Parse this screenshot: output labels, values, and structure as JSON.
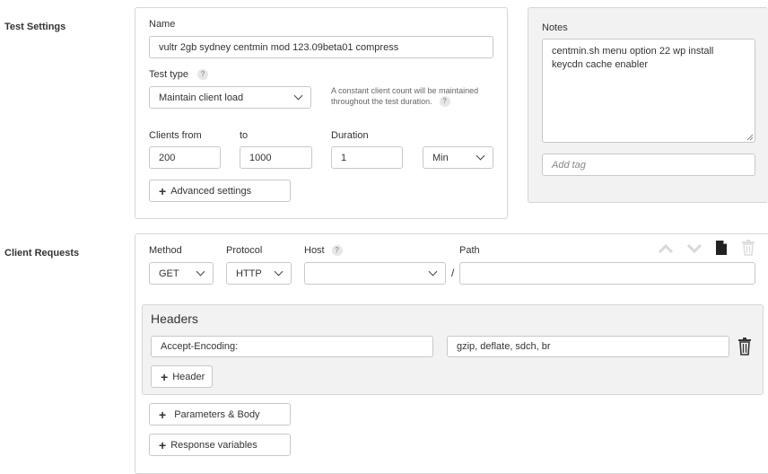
{
  "test_settings": {
    "section_label": "Test Settings",
    "name_label": "Name",
    "name_value": "vultr 2gb sydney centmin mod 123.09beta01 compress",
    "test_type_label": "Test type",
    "help_glyph": "?",
    "test_type_value": "Maintain client load",
    "test_type_hint_line1": "A constant client count will be maintained",
    "test_type_hint_line2": "throughout the test duration.",
    "clients_from_label": "Clients from",
    "clients_from_value": "200",
    "to_label": "to",
    "to_value": "1000",
    "duration_label": "Duration",
    "duration_value": "1",
    "duration_unit": "Min",
    "advanced_settings_label": "Advanced settings"
  },
  "notes": {
    "label": "Notes",
    "text": "centmin.sh menu option 22 wp install keycdn cache enabler",
    "tag_placeholder": "Add tag"
  },
  "client_requests": {
    "section_label": "Client Requests",
    "method_label": "Method",
    "method_value": "GET",
    "protocol_label": "Protocol",
    "protocol_value": "HTTP",
    "host_label": "Host",
    "host_value": "",
    "path_separator": "/",
    "path_label": "Path",
    "path_value": "",
    "headers_title": "Headers",
    "header_name": "Accept-Encoding:",
    "header_value": "gzip, deflate, sdch, br",
    "add_header_label": "Header",
    "parameters_body_label": "Parameters & Body",
    "response_variables_label": "Response variables"
  },
  "icons": [
    "chevron-up-icon",
    "chevron-down-icon",
    "file-icon",
    "trash-icon"
  ]
}
